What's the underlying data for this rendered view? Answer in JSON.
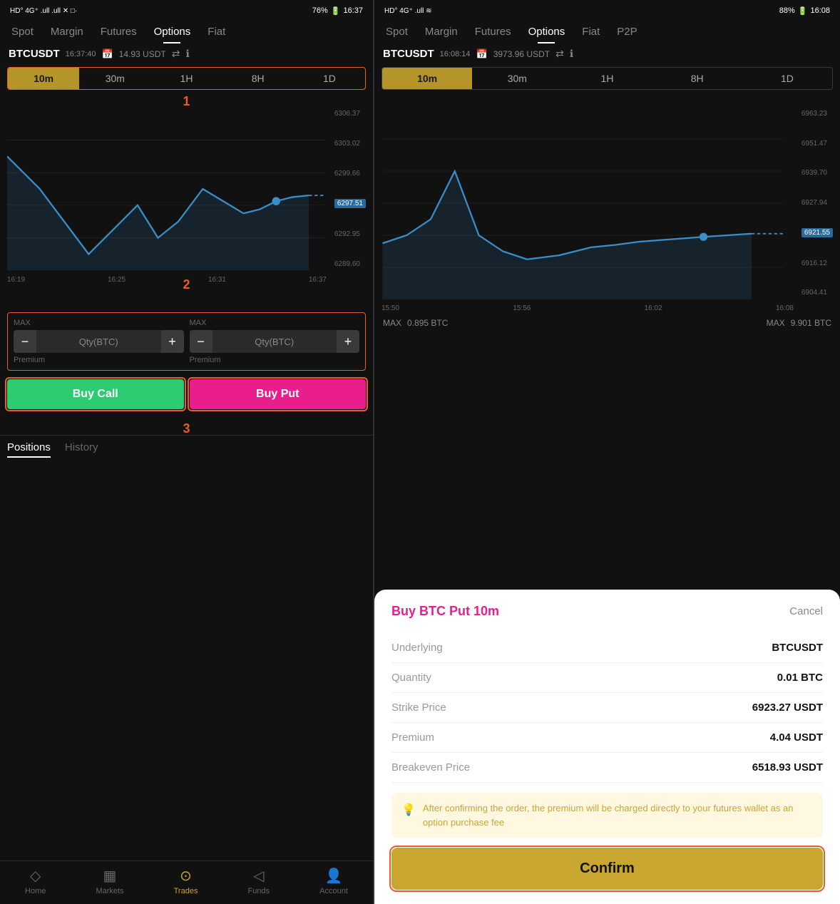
{
  "left": {
    "status": {
      "left": "HD° 4G⁺ .ull .ull ✕ □·",
      "battery": "76%",
      "time": "16:37"
    },
    "nav": {
      "tabs": [
        "Spot",
        "Margin",
        "Futures",
        "Options",
        "Fiat"
      ],
      "active": "Options"
    },
    "ticker": {
      "symbol": "BTCUSDT",
      "time": "16:37:40",
      "price": "14.93 USDT"
    },
    "periods": [
      "10m",
      "30m",
      "1H",
      "8H",
      "1D"
    ],
    "active_period": "10m",
    "chart": {
      "price_labels": [
        "6306.37",
        "6303.02",
        "6299.66",
        "6297.51",
        "6292.95",
        "6289.60"
      ],
      "time_labels": [
        "16:19",
        "16:25",
        "16:31",
        "16:37"
      ],
      "current_price": "6297.51"
    },
    "annotations": [
      "1",
      "2",
      "3"
    ],
    "order": {
      "left_max": "MAX",
      "left_qty": "Qty(BTC)",
      "left_premium": "Premium",
      "right_max": "MAX",
      "right_qty": "Qty(BTC)",
      "right_premium": "Premium"
    },
    "buy_call": "Buy Call",
    "buy_put": "Buy Put",
    "positions_tab": "Positions",
    "history_tab": "History"
  },
  "right": {
    "status": {
      "left": "HD° 4G⁺ .ull ≋",
      "battery": "88%",
      "time": "16:08"
    },
    "nav": {
      "tabs": [
        "Spot",
        "Margin",
        "Futures",
        "Options",
        "Fiat",
        "P2P"
      ],
      "active": "Options"
    },
    "ticker": {
      "symbol": "BTCUSDT",
      "time": "16:08:14",
      "price": "3973.96 USDT"
    },
    "periods": [
      "10m",
      "30m",
      "1H",
      "8H",
      "1D"
    ],
    "active_period": "10m",
    "chart": {
      "price_labels": [
        "6963.23",
        "6951.47",
        "6939.70",
        "6927.94",
        "6921.55",
        "6916.12",
        "6904.41"
      ],
      "time_labels": [
        "15:50",
        "15:56",
        "16:02",
        "16:08"
      ],
      "current_price": "6921.55"
    },
    "btc_max_left": "MAX",
    "btc_val_left": "0.895 BTC",
    "btc_max_right": "MAX",
    "btc_val_right": "9.901 BTC",
    "modal": {
      "title": "Buy BTC Put 10m",
      "cancel": "Cancel",
      "rows": [
        {
          "label": "Underlying",
          "value": "BTCUSDT"
        },
        {
          "label": "Quantity",
          "value": "0.01 BTC"
        },
        {
          "label": "Strike Price",
          "value": "6923.27 USDT"
        },
        {
          "label": "Premium",
          "value": "4.04 USDT"
        },
        {
          "label": "Breakeven Price",
          "value": "6518.93 USDT"
        }
      ],
      "notice": "After confirming the order, the premium will be charged directly to your futures wallet as an option purchase fee",
      "confirm": "Confirm"
    }
  },
  "bottom_nav": {
    "items": [
      "Home",
      "Markets",
      "Trades",
      "Funds",
      "Account"
    ],
    "active": "Trades",
    "icons": [
      "◇",
      "▦",
      "●",
      "◁",
      "👤"
    ]
  }
}
